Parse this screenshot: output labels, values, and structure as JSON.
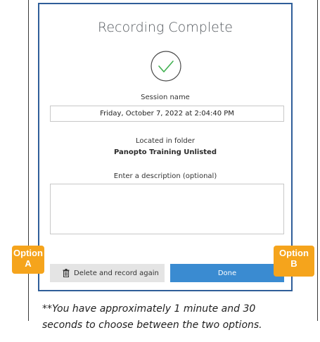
{
  "dialog": {
    "title": "Recording Complete",
    "session_label": "Session name",
    "session_value": "Friday, October 7, 2022 at 2:04:40 PM",
    "folder_label": "Located in folder",
    "folder_value": "Panopto Training Unlisted",
    "description_label": "Enter a description (optional)",
    "description_value": "",
    "delete_button_label": "Delete and record again",
    "delete_icon": "trash-icon",
    "done_button_label": "Done",
    "success_icon": "checkmark-circle-icon"
  },
  "callouts": {
    "option_a": [
      "Option",
      "A"
    ],
    "option_b": [
      "Option",
      "B"
    ]
  },
  "note": {
    "line1": "**You have approximately 1 minute and 30",
    "line2": "seconds to choose between the two options."
  },
  "colors": {
    "dialog_border": "#2f5e99",
    "checkmark": "#3fb04f",
    "done_button": "#3a8bd1",
    "delete_button": "#e4e4e4",
    "callout": "#f5a41c"
  }
}
